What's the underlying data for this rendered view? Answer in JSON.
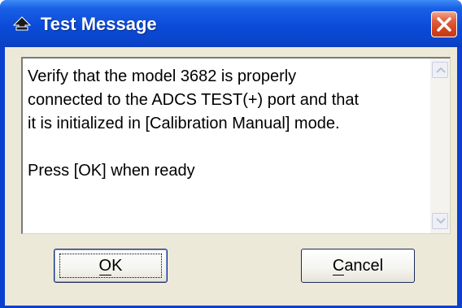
{
  "window": {
    "title": "Test Message",
    "icon": "joystick-icon",
    "close_icon": "close-icon"
  },
  "message": {
    "lines": [
      "Verify that the model 3682 is properly",
      "connected to the ADCS TEST(+) port and that",
      "it is initialized in [Calibration Manual] mode."
    ],
    "prompt": "Press [OK] when ready"
  },
  "buttons": {
    "ok_mnemonic": "O",
    "ok_rest": "K",
    "cancel_mnemonic": "C",
    "cancel_rest": "ancel"
  },
  "colors": {
    "titlebar": "#0b4bd8",
    "close_button": "#d3441f",
    "dialog_face": "#ece9d8"
  }
}
